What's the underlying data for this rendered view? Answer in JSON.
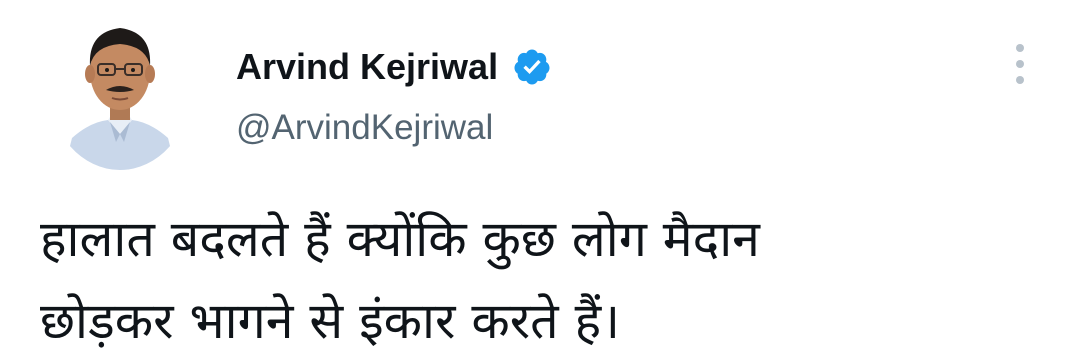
{
  "author": {
    "display_name": "Arvind Kejriwal",
    "handle": "@ArvindKejriwal",
    "avatar_icon": "profile-photo",
    "verified_icon": "verified-badge-icon",
    "verified_color": "#1d9bf0"
  },
  "menu": {
    "icon": "more-options-icon"
  },
  "tweet": {
    "line1": "हालात बदलते हैं क्योंकि कुछ लोग मैदान",
    "line2": "छोड़कर भागने से इंकार करते हैं।"
  },
  "colors": {
    "text": "#0f1419",
    "secondary": "#536471",
    "menu_dots": "#b8c2cb"
  }
}
